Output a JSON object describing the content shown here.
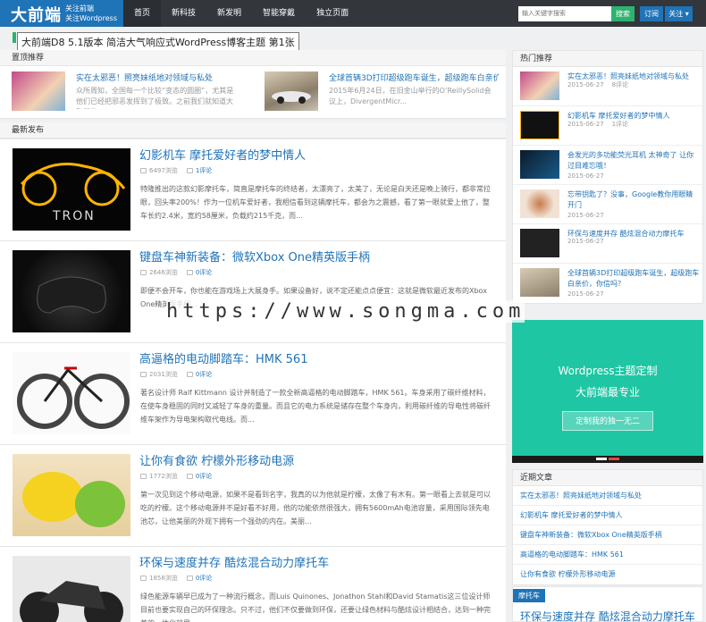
{
  "header": {
    "logo": "大前端",
    "logo_sub_1": "关注前端",
    "logo_sub_2": "关注Wordpress",
    "nav": [
      "首页",
      "新科技",
      "新发明",
      "智能穿戴",
      "独立页面"
    ],
    "search_placeholder": "输入关键字搜索",
    "search_button": "搜索",
    "subscribe_button": "订阅",
    "follow_button": "关注",
    "accent": "#1f73b7",
    "green": "#2db36f"
  },
  "tooltip": "大前端D8 5.1版本 简洁大气响应式WordPress博客主题 第1张",
  "sticky": {
    "heading": "置顶推荐",
    "items": [
      {
        "title": "实在太邪恶！照亮妹纸地对领域与私处",
        "desc": "众所周知，全国每一个比较“变态的圆圈”，尤其是他们已经把邪恶发挥到了极致。之前我们就知道大胸器做..."
      },
      {
        "title": "全球首辆3D打印超级跑车诞生，超级跑车白亲价，",
        "desc": "2015年6月24日，在旧金山举行的O’ReillySolid会议上，DivergentMicr..."
      }
    ]
  },
  "latest": {
    "heading": "最新发布",
    "posts": [
      {
        "title": "幻影机车 摩托爱好者的梦中情人",
        "views": "6497浏览",
        "comments": "1评论",
        "excerpt": "特隆推出的这款幻影摩托车，简直是摩托车的终结者，太漂亮了，太美了，无论是白天还是晚上骑行，都非常拉眼，回头率200%！作为一位机车爱好者，我相信看到这辆摩托车，都会为之震撼，看了第一眼就爱上他了，整车长约2.4米，宽约58厘米，负载约215千克，而..."
      },
      {
        "title": "键盘车神新装备：微软Xbox One精英版手柄",
        "views": "2646浏览",
        "comments": "0评论",
        "excerpt": "即便不会开车，你也能在游戏场上大展身手。如果设备好，说不定还能点点便宜：这就是微软最近发布的Xbox One精英版手柄..."
      },
      {
        "title": "高逼格的电动脚踏车：HMK 561",
        "views": "2031浏览",
        "comments": "0评论",
        "excerpt": "著名设计师 Ralf Kittmann 设计并制造了一款全新高逼格的电动脚踏车，HMK 561。车身采用了碳纤维材料，在使车身稳固的同时又减轻了车身的重量。而且它的电力系统是储存在整个车身内，利用碳纤维的导电性将碳纤维车架作为导电架构取代电线。而..."
      },
      {
        "title": "让你有食欲 柠檬外形移动电源",
        "views": "1772浏览",
        "comments": "0评论",
        "excerpt": "第一次见到这个移动电源，如果不是看到名字，我真的以为他就是柠檬，太像了有木有。第一眼看上去就是可以吃的柠檬。这个移动电源并不是好看不好用，他的功能依然很强大，拥有5600mAh电池容量，采用国际领先电池芯，让他美丽的外观下拥有一个强劲的内在。美丽..."
      },
      {
        "title": "环保与速度并存 酷炫混合动力摩托车",
        "views": "1858浏览",
        "comments": "0评论",
        "excerpt": "绿色能源车辆早已成为了一种流行概念，而Luis Quinones、Jonathon Stahl和David Stamatis这三位设计师目前也要实现自己的环保理念。只不过，他们不仅要做到环保，还要让绿色材料与酷炫设计相结合，达到一种完美的一体化效果。"
      }
    ]
  },
  "hot": {
    "heading": "热门推荐",
    "items": [
      {
        "title": "实在太邪恶！照亮妹纸地对领域与私处",
        "date": "2015-06-27",
        "comments": "8评论"
      },
      {
        "title": "幻影机车 摩托爱好者的梦中情人",
        "date": "2015-06-27",
        "comments": "1评论"
      },
      {
        "title": "会发光的多功能荧光耳机 太神奇了 让你过目难忘哦！",
        "date": "2015-06-27",
        "comments": ""
      },
      {
        "title": "忘带钥匙了？没事，Google教你用眼睛开门",
        "date": "2015-06-27",
        "comments": ""
      },
      {
        "title": "环保与速度并存 酷炫混合动力摩托车",
        "date": "2015-06-27",
        "comments": ""
      },
      {
        "title": "全球首辆3D打印超级跑车诞生，超级跑车白亲价，你信吗？",
        "date": "2015-06-27",
        "comments": ""
      }
    ]
  },
  "ad": {
    "title": "Wordpress主题定制",
    "subtitle": "大前端最专业",
    "button": "定制我的独一无二",
    "bg": "#1fc6a4"
  },
  "recent": {
    "heading": "近期文章",
    "items": [
      "实在太邪恶！照亮妹纸地对领域与私处",
      "幻影机车 摩托爱好者的梦中情人",
      "键盘车神新装备：微软Xbox One精英版手柄",
      "高逼格的电动脚踏车：HMK 561",
      "让你有食欲 柠檬外形移动电源"
    ]
  },
  "tagbox": {
    "badge": "摩托车",
    "title": "环保与速度并存 酷炫混合动力摩托车"
  },
  "watermark": "https://www.songma.com"
}
